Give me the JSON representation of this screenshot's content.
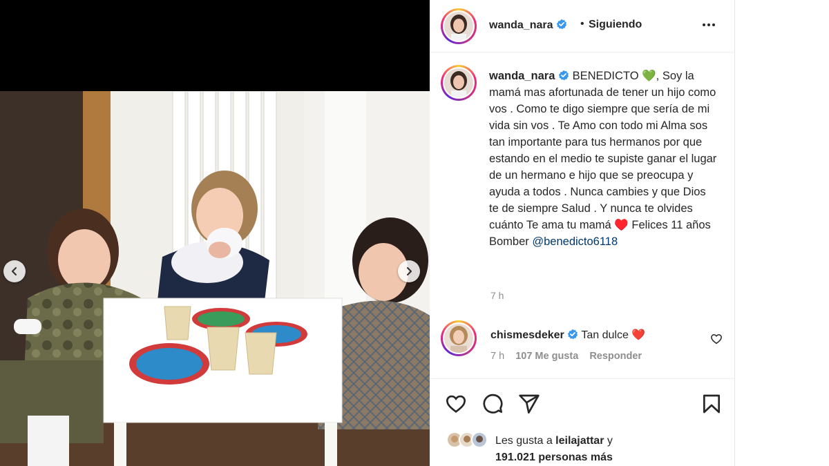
{
  "post": {
    "username": "wanda_nara",
    "separator": "•",
    "follow_status": "Siguiendo",
    "more_label": "•••",
    "caption_text": "BENEDICTO 💚, Soy la mamá mas afortunada de tener un hijo como vos . Como te digo siempre que sería de mi vida sin vos . Te Amo con todo mi Alma sos tan importante para tus hermanos por que estando en el medio te supiste ganar el lugar de un hermano e hijo que se preocupa y ayuda a todos . Nunca cambies y que Dios te de siempre Salud . Y nunca te olvides cuánto Te ama tu mamá ♥️ Felices 11 años Bomber",
    "caption_mention": "@benedicto6118",
    "time_ago": "7 h"
  },
  "comment": {
    "username": "chismesdeker",
    "text": "Tan dulce ❤️",
    "time_ago": "7 h",
    "likes": "107 Me gusta",
    "reply_label": "Responder"
  },
  "likes": {
    "line1_prefix": "Les gusta a ",
    "line1_user": "leilajattar",
    "line1_suffix": " y",
    "line2": "191.021 personas más"
  },
  "colors": {
    "verified": "#3897f0",
    "text": "#262626",
    "muted": "#8e8e8e",
    "link": "#00376b"
  },
  "icons": {
    "prev": "chevron-left-icon",
    "next": "chevron-right-icon",
    "like": "heart-icon",
    "comment": "comment-icon",
    "share": "send-icon",
    "save": "bookmark-icon",
    "more": "more-options-icon"
  }
}
